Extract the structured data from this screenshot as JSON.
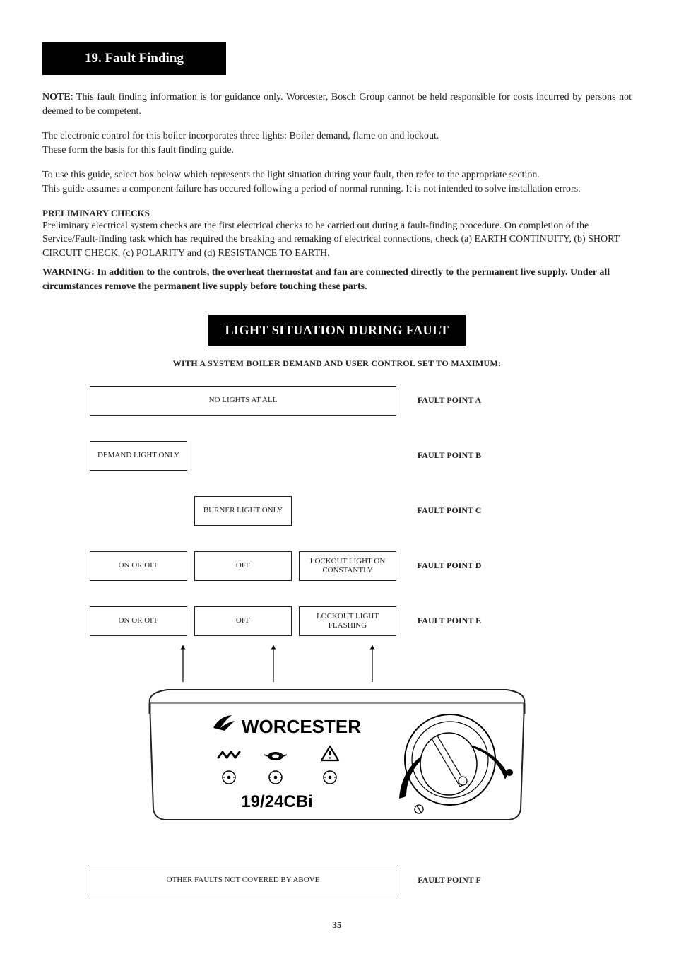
{
  "section": {
    "number": "19.",
    "title": "Fault Finding"
  },
  "note": {
    "label": "NOTE",
    "text": ": This fault finding information is for guidance only. Worcester, Bosch Group cannot be held responsible for costs incurred by persons not deemed to be competent."
  },
  "para1": "The electronic control for this boiler incorporates three lights: Boiler demand, flame on and lockout.",
  "para1b": "These form the basis for this fault finding guide.",
  "para2": "To use this guide, select box below which represents the light situation during your fault, then refer to the appropriate section.",
  "para2b": "This guide assumes a component failure has occured following a period of normal running. It is not intended to solve installation errors.",
  "prelim": {
    "title": "PRELIMINARY CHECKS",
    "text": "Preliminary electrical system checks are the first electrical checks to be carried out during a fault-finding procedure. On completion of the Service/Fault-finding task which has required the breaking and remaking of electrical connections, check (a) EARTH CONTINUITY, (b) SHORT CIRCUIT CHECK, (c) POLARITY and (d) RESISTANCE TO EARTH."
  },
  "warning": "WARNING: In addition to the controls, the overheat thermostat and fan are connected directly to the permanent live supply. Under all circumstances remove the permanent live supply before touching these parts.",
  "light_header": "LIGHT SITUATION DURING FAULT",
  "subhead": "WITH A SYSTEM BOILER DEMAND AND USER CONTROL SET TO MAXIMUM:",
  "rows": {
    "a": {
      "wide": "NO LIGHTS AT ALL",
      "fp": "FAULT POINT A"
    },
    "b": {
      "col1": "DEMAND LIGHT ONLY",
      "fp": "FAULT POINT B"
    },
    "c": {
      "col2": "BURNER LIGHT ONLY",
      "fp": "FAULT POINT C"
    },
    "d": {
      "col1": "ON OR OFF",
      "col2": "OFF",
      "col3": "LOCKOUT LIGHT ON CONSTANTLY",
      "fp": "FAULT POINT D"
    },
    "e": {
      "col1": "ON OR OFF",
      "col2": "OFF",
      "col3": "LOCKOUT LIGHT FLASHING",
      "fp": "FAULT POINT E"
    },
    "f": {
      "wide": "OTHER FAULTS NOT COVERED BY ABOVE",
      "fp": "FAULT POINT F"
    }
  },
  "panel": {
    "brand": "WORCESTER",
    "model": "19/24CBi"
  },
  "page_number": "35"
}
